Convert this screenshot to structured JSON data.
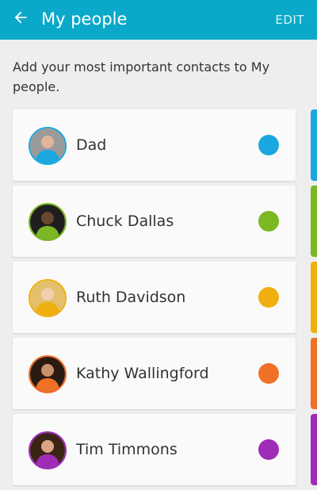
{
  "header": {
    "title": "My people",
    "back_icon": "arrow-left-icon",
    "edit_label": "EDIT",
    "background_color": "#0ba9c9"
  },
  "description": "Add your most important contacts to My people.",
  "contacts": [
    {
      "name": "Dad",
      "color": "#1aa7e0",
      "avatar_icon": "person-avatar-icon"
    },
    {
      "name": "Chuck Dallas",
      "color": "#7ab824",
      "avatar_icon": "person-avatar-icon"
    },
    {
      "name": "Ruth Davidson",
      "color": "#efb00f",
      "avatar_icon": "person-avatar-icon"
    },
    {
      "name": "Kathy Wallingford",
      "color": "#f07026",
      "avatar_icon": "person-avatar-icon"
    },
    {
      "name": "Tim Timmons",
      "color": "#a02bb8",
      "avatar_icon": "person-avatar-icon"
    }
  ]
}
